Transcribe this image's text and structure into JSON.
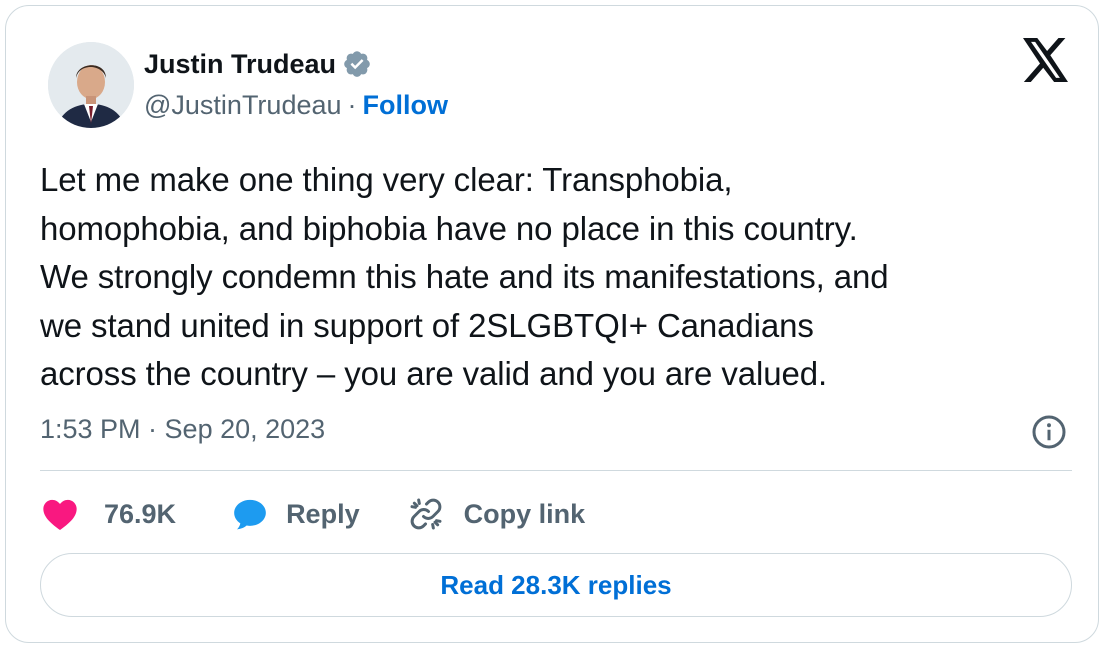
{
  "author": {
    "name": "Justin Trudeau",
    "handle": "@JustinTrudeau",
    "separator": "·",
    "follow_label": "Follow",
    "verified_badge_icon": "verified-badge-icon",
    "avatar_icon": "profile-photo"
  },
  "platform_logo_icon": "x-logo-icon",
  "tweet": {
    "text": "Let me make one thing very clear: Transphobia,\nhomophobia, and biphobia have no place in this country.\nWe strongly condemn this hate and its manifestations, and\nwe stand united in support of 2SLGBTQI+ Canadians\nacross the country – you are valid and you are valued.",
    "timestamp": "1:53 PM · Sep 20, 2023"
  },
  "actions": {
    "like_count": "76.9K",
    "reply_label": "Reply",
    "copy_link_label": "Copy link"
  },
  "read_replies_label": "Read 28.3K replies",
  "colors": {
    "accent": "#006fd6",
    "like": "#f91880",
    "reply_icon": "#1d9bf0",
    "verified": "#829aab",
    "muted_text": "#536471",
    "text": "#0f1419",
    "border": "#cfd9de"
  }
}
